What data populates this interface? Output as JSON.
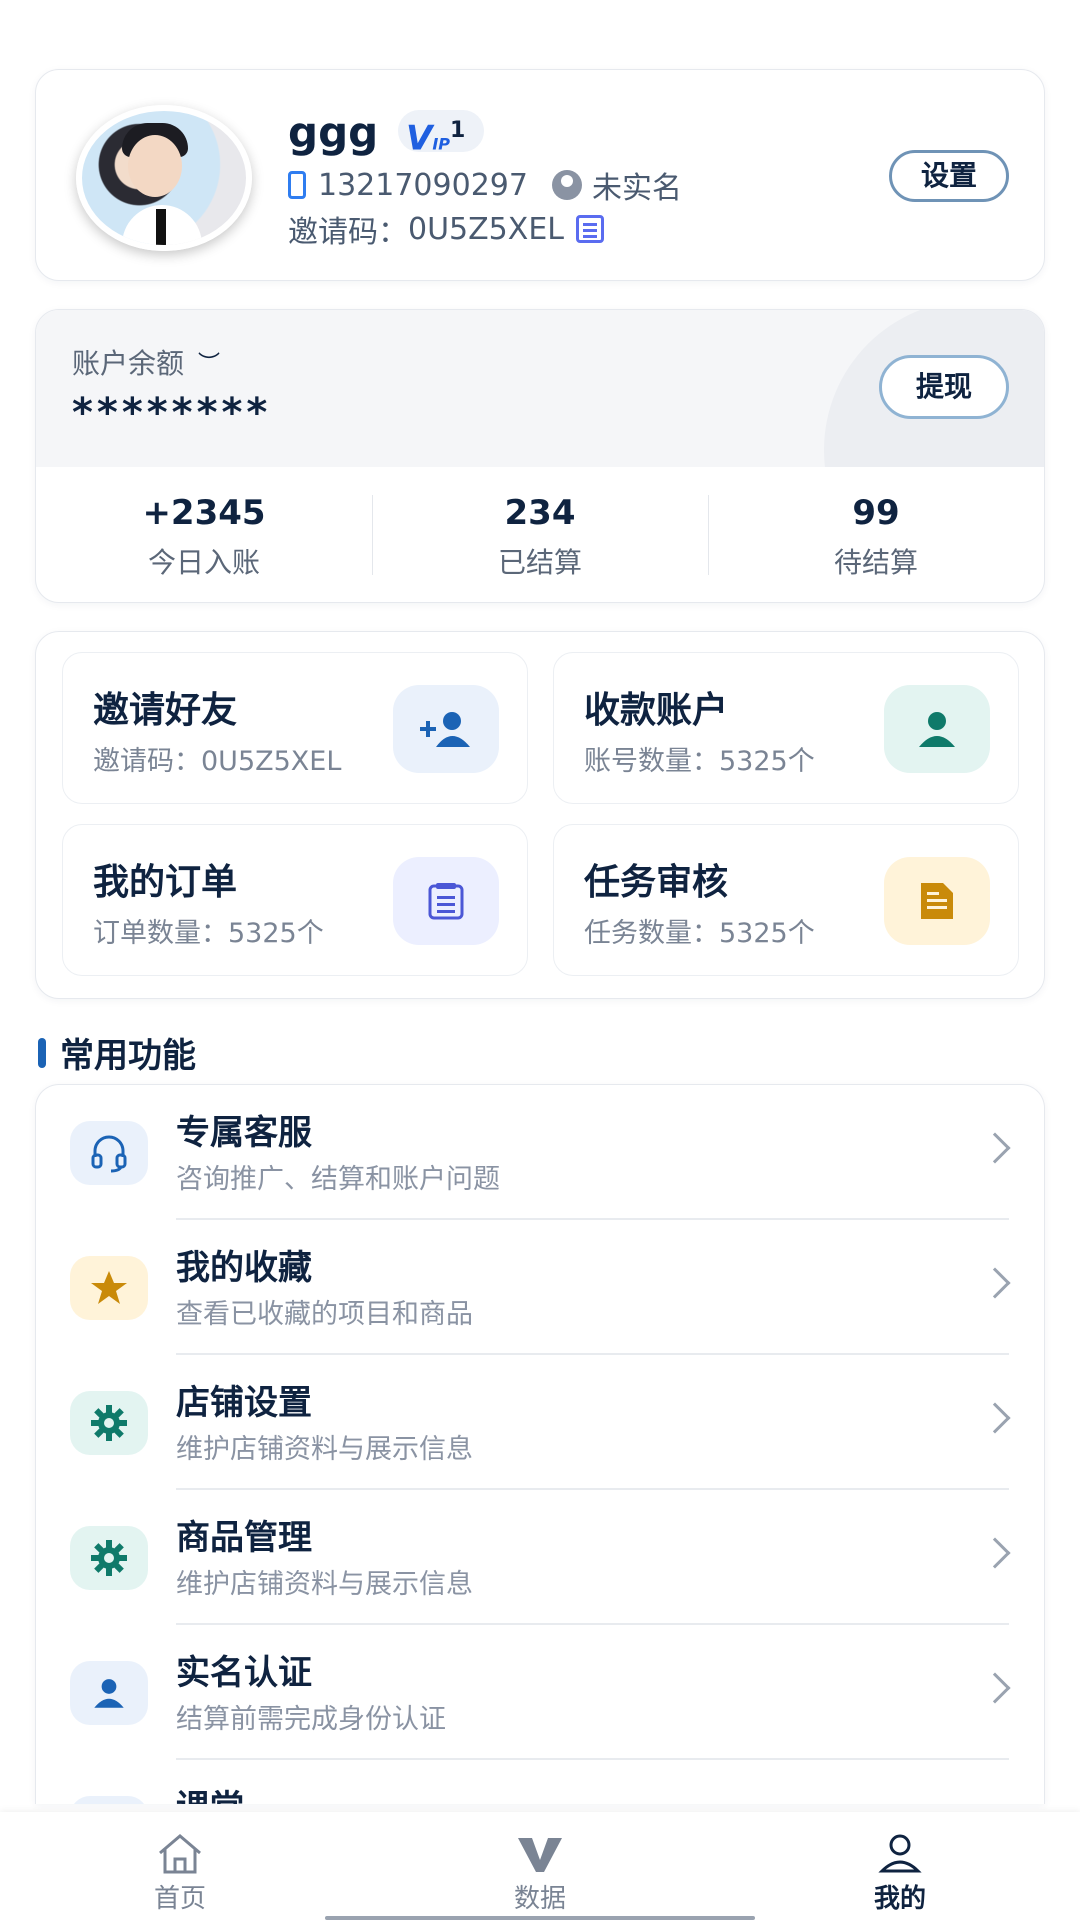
{
  "profile": {
    "username": "ggg",
    "vip_label": "V",
    "vip_sub": "IP",
    "vip_level": "1",
    "phone": "13217090297",
    "verify_status": "未实名",
    "invite_label": "邀请码：",
    "invite_code": "0U5Z5XEL",
    "settings_label": "设置"
  },
  "balance": {
    "label": "账户余额",
    "value": "********",
    "withdraw_label": "提现",
    "stats": [
      {
        "value": "+2345",
        "label": "今日入账"
      },
      {
        "value": "234",
        "label": "已结算"
      },
      {
        "value": "99",
        "label": "待结算"
      }
    ]
  },
  "quick": [
    {
      "title": "邀请好友",
      "sub": "邀请码：0U5Z5XEL",
      "icon": "add-user-icon",
      "bg": "#eaf1fb",
      "fg": "#1b63b5"
    },
    {
      "title": "收款账户",
      "sub": "账号数量：5325个",
      "icon": "person-icon",
      "bg": "#e3f4f1",
      "fg": "#0f7a6a"
    },
    {
      "title": "我的订单",
      "sub": "订单数量：5325个",
      "icon": "list-icon",
      "bg": "#ecefff",
      "fg": "#4b57d6"
    },
    {
      "title": "任务审核",
      "sub": "任务数量：5325个",
      "icon": "document-icon",
      "bg": "#fff3d9",
      "fg": "#c98a0a"
    }
  ],
  "section_title": "常用功能",
  "menu": [
    {
      "title": "专属客服",
      "sub": "咨询推广、结算和账户问题",
      "icon": "headset-icon",
      "bg": "#eaf1fb",
      "fg": "#1b63b5"
    },
    {
      "title": "我的收藏",
      "sub": "查看已收藏的项目和商品",
      "icon": "star-icon",
      "bg": "#fff3d9",
      "fg": "#c98a0a"
    },
    {
      "title": "店铺设置",
      "sub": "维护店铺资料与展示信息",
      "icon": "gear-icon",
      "bg": "#e3f4f1",
      "fg": "#0f7a6a"
    },
    {
      "title": "商品管理",
      "sub": "维护店铺资料与展示信息",
      "icon": "gear-icon",
      "bg": "#e3f4f1",
      "fg": "#0f7a6a"
    },
    {
      "title": "实名认证",
      "sub": "结算前需完成身份认证",
      "icon": "person-icon",
      "bg": "#eaf1fb",
      "fg": "#1b63b5"
    },
    {
      "title": "课堂",
      "sub": "",
      "icon": "book-icon",
      "bg": "#eaf1fb",
      "fg": "#1b63b5"
    }
  ],
  "nav": [
    {
      "label": "首页",
      "icon": "home-icon"
    },
    {
      "label": "数据",
      "icon": "v-logo-icon"
    },
    {
      "label": "我的",
      "icon": "user-icon"
    }
  ]
}
